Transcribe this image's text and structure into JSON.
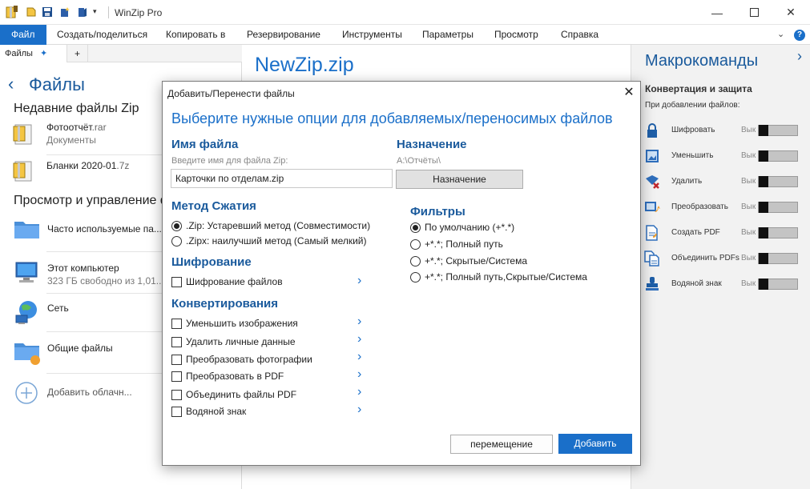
{
  "window": {
    "title": "WinZip Pro"
  },
  "ribbon": {
    "tabs": [
      "Файл",
      "Создать/поделиться",
      "Копировать в",
      "Резервирование",
      "Инструменты",
      "Параметры",
      "Просмотр",
      "Справка"
    ],
    "help_label": "?"
  },
  "left_pane": {
    "tab_label": "Файлы",
    "add_tab_label": "+",
    "heading": "Файлы",
    "recent_section": "Недавние файлы Zip",
    "recent_files": [
      {
        "name": "Фотоотчёт",
        "ext": ".rar",
        "sub": "Документы"
      },
      {
        "name": "Бланки 2020-01",
        "ext": ".7z",
        "sub": ""
      }
    ],
    "browse_section": "Просмотр и управление ф",
    "locations": [
      {
        "title": "Часто используемые па...",
        "sub": ""
      },
      {
        "title": "Этот компьютер",
        "sub": "323 ГБ свободно из 1,01..."
      },
      {
        "title": "Сеть",
        "sub": ""
      },
      {
        "title": "Общие файлы",
        "sub": ""
      },
      {
        "title": "Добавить облачн...",
        "sub": ""
      }
    ]
  },
  "center": {
    "zip_title": "NewZip.zip"
  },
  "right_pane": {
    "title": "Макрокоманды",
    "section": "Конвертация и защита",
    "subtitle": "При добавлении файлов:",
    "state_label": "Вык",
    "actions": [
      {
        "label": "Шифровать",
        "icon": "lock-icon"
      },
      {
        "label": "Уменьшить",
        "icon": "resize-image-icon"
      },
      {
        "label": "Удалить",
        "icon": "remove-data-icon"
      },
      {
        "label": "Преобразовать",
        "icon": "convert-photo-icon"
      },
      {
        "label": "Создать PDF",
        "icon": "create-pdf-icon"
      },
      {
        "label": "Объединить PDFs",
        "icon": "merge-pdf-icon"
      },
      {
        "label": "Водяной знак",
        "icon": "watermark-stamp-icon"
      }
    ]
  },
  "dialog": {
    "title": "Добавить/Перенести файлы",
    "close_label": "✕",
    "heading": "Выберите нужные опции для добавляемых/переносимых файлов",
    "filename": {
      "label": "Имя файла",
      "hint": "Введите имя для файла Zip:",
      "value": "Карточки по отделам.zip"
    },
    "destination": {
      "label": "Назначение",
      "path": "A:\\Отчёты\\",
      "button": "Назначение"
    },
    "compression": {
      "label": "Метод Сжатия",
      "options": [
        {
          "label": ".Zip: Устаревший метод (Совместимости)",
          "selected": true
        },
        {
          "label": ".Zipx: наилучший метод (Самый мелкий)",
          "selected": false
        }
      ]
    },
    "filters": {
      "label": "Фильтры",
      "options": [
        {
          "label": "По умолчанию (+*.*)",
          "selected": true
        },
        {
          "label": "+*.*; Полный путь",
          "selected": false
        },
        {
          "label": "+*.*; Скрытые/Система",
          "selected": false
        },
        {
          "label": "+*.*; Полный путь,Скрытые/Система",
          "selected": false
        }
      ]
    },
    "encryption": {
      "label": "Шифрование",
      "option": "Шифрование файлов"
    },
    "conversions": {
      "label": "Конвертирования",
      "options": [
        "Уменьшить изображения",
        "Удалить личные данные",
        "Преобразовать фотографии",
        "Преобразовать в PDF",
        "Объединить файлы PDF",
        "Водяной знак"
      ]
    },
    "move_button": "перемещение",
    "add_button": "Добавить"
  },
  "colors": {
    "accent": "#1a6fc9",
    "heading_blue": "#1a5a9c",
    "right_pane_bg": "#f2f2f2"
  }
}
